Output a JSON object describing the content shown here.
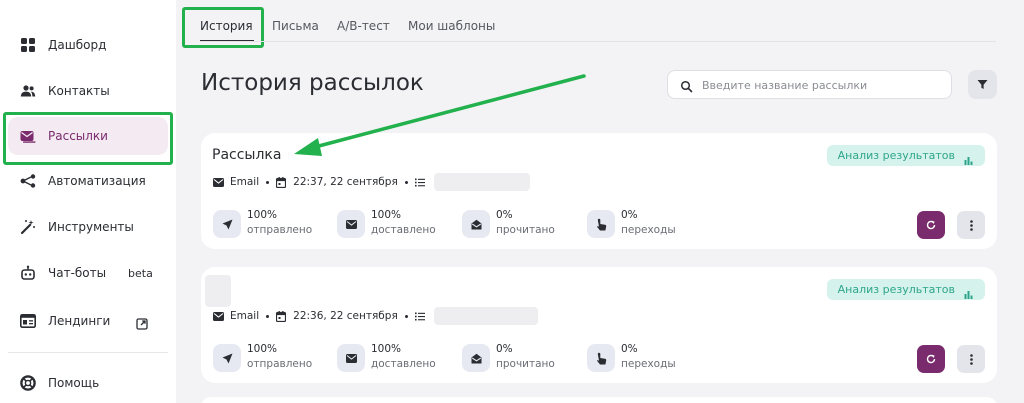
{
  "sidebar": {
    "items": [
      {
        "label": "Дашборд",
        "icon": "grid-icon"
      },
      {
        "label": "Контакты",
        "icon": "users-icon"
      },
      {
        "label": "Рассылки",
        "icon": "mail-icon"
      },
      {
        "label": "Автоматизация",
        "icon": "flow-icon"
      },
      {
        "label": "Инструменты",
        "icon": "magic-wand-icon"
      },
      {
        "label": "Чат-боты",
        "icon": "robot-icon",
        "tag": "beta"
      },
      {
        "label": "Лендинги",
        "icon": "landing-icon"
      },
      {
        "label": "Помощь",
        "icon": "lifebuoy-icon"
      }
    ],
    "active_color": "#7a2b6e"
  },
  "tabs": [
    {
      "label": "История"
    },
    {
      "label": "Письма"
    },
    {
      "label": "A/B-тест"
    },
    {
      "label": "Мои шаблоны"
    }
  ],
  "page": {
    "title": "История рассылок"
  },
  "search": {
    "placeholder": "Введите название рассылки"
  },
  "cards": [
    {
      "title": "Рассылка",
      "badge": "Анализ результатов",
      "channel": "Email",
      "time": "22:37, 22 сентября",
      "stats": [
        {
          "value": "100%",
          "label": "отправлено"
        },
        {
          "value": "100%",
          "label": "доставлено"
        },
        {
          "value": "0%",
          "label": "прочитано"
        },
        {
          "value": "0%",
          "label": "переходы"
        }
      ]
    },
    {
      "title": "",
      "badge": "Анализ результатов",
      "channel": "Email",
      "time": "22:36, 22 сентября",
      "stats": [
        {
          "value": "100%",
          "label": "отправлено"
        },
        {
          "value": "100%",
          "label": "доставлено"
        },
        {
          "value": "0%",
          "label": "прочитано"
        },
        {
          "value": "0%",
          "label": "переходы"
        }
      ]
    }
  ],
  "colors": {
    "accent": "#7a2b6e",
    "annotation": "#22b14c",
    "badge_text": "#2ea58b",
    "badge_bg": "#d5f3ec"
  }
}
